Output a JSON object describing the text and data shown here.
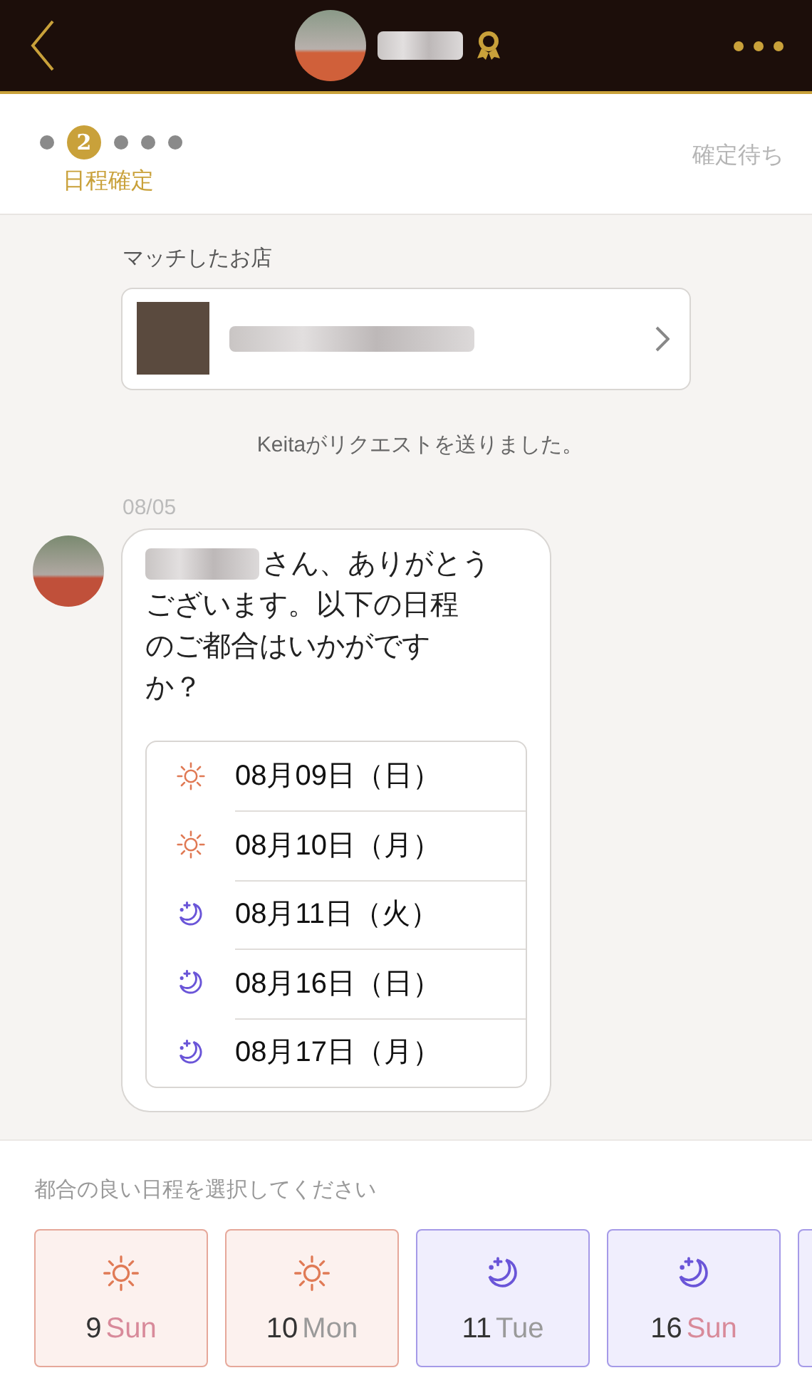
{
  "progress": {
    "steps": [
      {
        "selected": false
      },
      {
        "selected": true,
        "number": "2"
      },
      {
        "selected": false
      },
      {
        "selected": false
      },
      {
        "selected": false
      }
    ],
    "step_label": "日程確定",
    "status": "確定待ち"
  },
  "shop": {
    "heading": "マッチしたお店"
  },
  "system_message": "Keitaがリクエストを送りました。",
  "message": {
    "date": "08/05",
    "name_suffix": "さん、ありがとう",
    "text": "ございます。以下の日程のご都合はいかがですか？",
    "options": [
      {
        "kind": "day",
        "label": "08月09日（日）"
      },
      {
        "kind": "day",
        "label": "08月10日（月）"
      },
      {
        "kind": "night",
        "label": "08月11日（火）"
      },
      {
        "kind": "night",
        "label": "08月16日（日）"
      },
      {
        "kind": "night",
        "label": "08月17日（月）"
      }
    ]
  },
  "picker": {
    "prompt": "都合の良い日程を選択してください",
    "cards": [
      {
        "kind": "day",
        "day": "9",
        "weekday": "Sun",
        "color": "#d88a9a"
      },
      {
        "kind": "day",
        "day": "10",
        "weekday": "Mon",
        "color": "#9a9a9a"
      },
      {
        "kind": "night",
        "day": "11",
        "weekday": "Tue",
        "color": "#9a9a9a"
      },
      {
        "kind": "night",
        "day": "16",
        "weekday": "Sun",
        "color": "#d88a9a"
      },
      {
        "kind": "night"
      }
    ]
  }
}
